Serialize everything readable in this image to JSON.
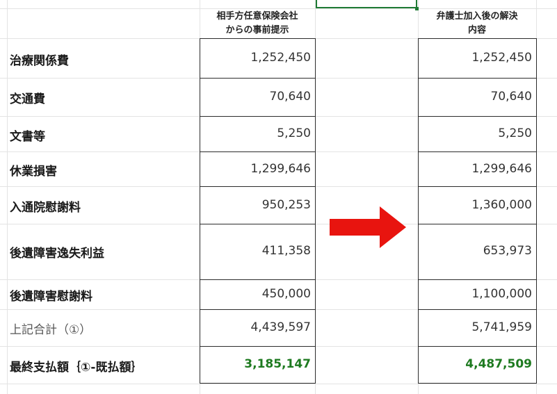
{
  "headers": {
    "before": [
      "相手方任意保険会社",
      "からの事前提示"
    ],
    "after": [
      "弁護士加入後の解決",
      "内容"
    ]
  },
  "rows": [
    {
      "label": "治療関係費",
      "before": "1,252,450",
      "after": "1,252,450"
    },
    {
      "label": "交通費",
      "before": "70,640",
      "after": "70,640"
    },
    {
      "label": "文書等",
      "before": "5,250",
      "after": "5,250"
    },
    {
      "label": "休業損害",
      "before": "1,299,646",
      "after": "1,299,646"
    },
    {
      "label": "入通院慰謝料",
      "before": "950,253",
      "after": "1,360,000"
    },
    {
      "label": "後遺障害逸失利益",
      "before": "411,358",
      "after": "653,973"
    },
    {
      "label": "後遺障害慰謝料",
      "before": "450,000",
      "after": "1,100,000"
    },
    {
      "label": "上記合計（①）",
      "before": "4,439,597",
      "after": "5,741,959"
    },
    {
      "label": "最終支払額｛①-既払額｝",
      "before": "3,185,147",
      "after": "4,487,509"
    }
  ],
  "colors": {
    "total_green": "#1e7a20",
    "arrow_red": "#e8140f",
    "selection_green": "#1e7a34"
  },
  "icons": {
    "arrow": "right-arrow-icon"
  }
}
